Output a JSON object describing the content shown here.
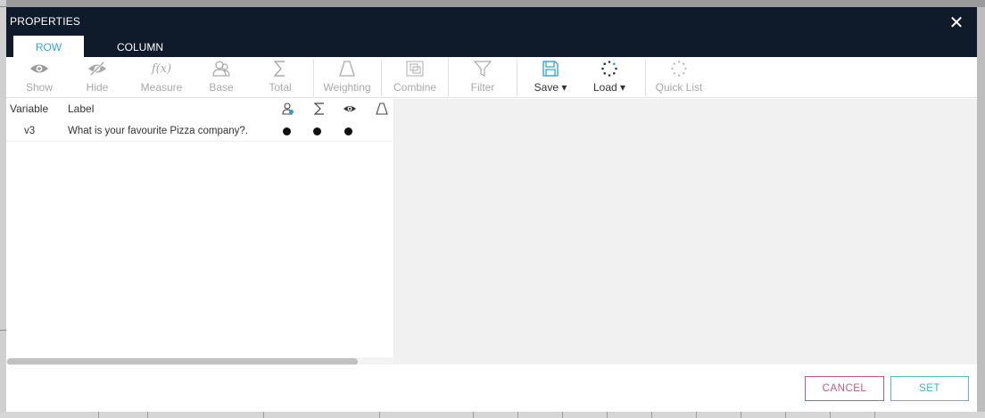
{
  "dialog": {
    "title": "PROPERTIES",
    "close_symbol": "✕",
    "tabs": [
      {
        "label": "ROW",
        "active": true
      },
      {
        "label": "COLUMN",
        "active": false
      }
    ]
  },
  "toolbar": {
    "items": [
      {
        "label": "Show",
        "icon": "eye-icon"
      },
      {
        "label": "Hide",
        "icon": "eye-slash-icon"
      },
      {
        "label": "Measure",
        "icon": "function-icon",
        "icon_text": "f(x)"
      },
      {
        "label": "Base",
        "icon": "users-icon"
      },
      {
        "label": "Total",
        "icon": "sigma-icon"
      },
      {
        "label": "Weighting",
        "icon": "weight-icon"
      },
      {
        "label": "Combine",
        "icon": "combine-icon"
      },
      {
        "label": "Filter",
        "icon": "funnel-icon"
      },
      {
        "label": "Save ▾",
        "icon": "floppy-disk-icon"
      },
      {
        "label": "Load ▾",
        "icon": "loading-spinner-icon"
      },
      {
        "label": "Quick List",
        "icon": "loading-spinner-icon"
      }
    ]
  },
  "table": {
    "headers": {
      "variable": "Variable",
      "label": "Label"
    },
    "header_icons": [
      "base-icon",
      "sigma-icon",
      "eye-icon",
      "weight-icon"
    ],
    "rows": [
      {
        "variable": "v3",
        "label": "What is your favourite Pizza company?.",
        "base": true,
        "total": true,
        "show": true
      }
    ]
  },
  "footer": {
    "cancel_label": "CANCEL",
    "set_label": "SET"
  },
  "colors": {
    "header_bg": "#0f1b2a",
    "active_tab_text": "#31a9d6",
    "cancel_border": "#c9587a",
    "set_border": "#55bfc0"
  }
}
